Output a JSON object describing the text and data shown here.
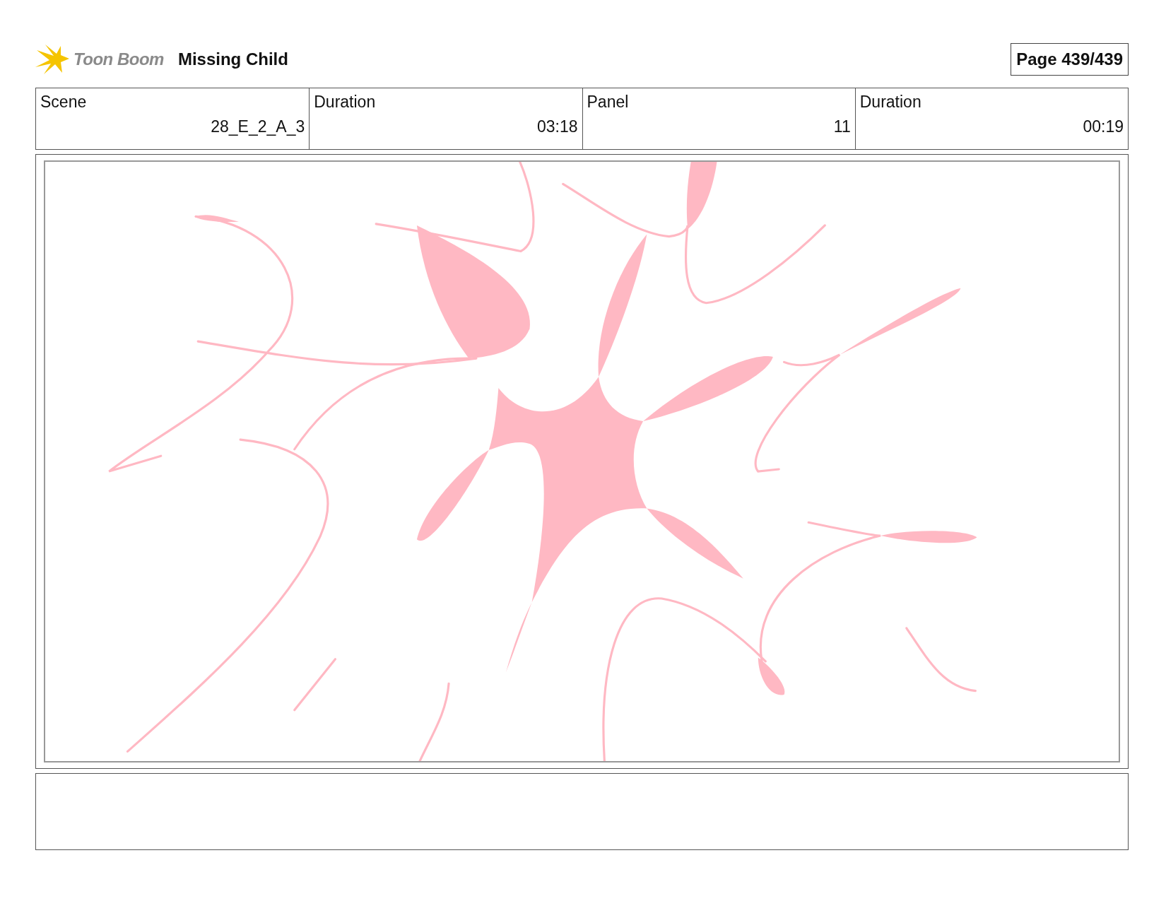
{
  "header": {
    "logo_text": "Toon Boom",
    "title": "Missing Child",
    "page": "Page 439/439"
  },
  "info_table": {
    "columns": [
      "Scene",
      "Duration",
      "Panel",
      "Duration"
    ],
    "rows": [
      [
        "28_E_2_A_3",
        "03:18",
        "11",
        "00:19"
      ]
    ]
  }
}
